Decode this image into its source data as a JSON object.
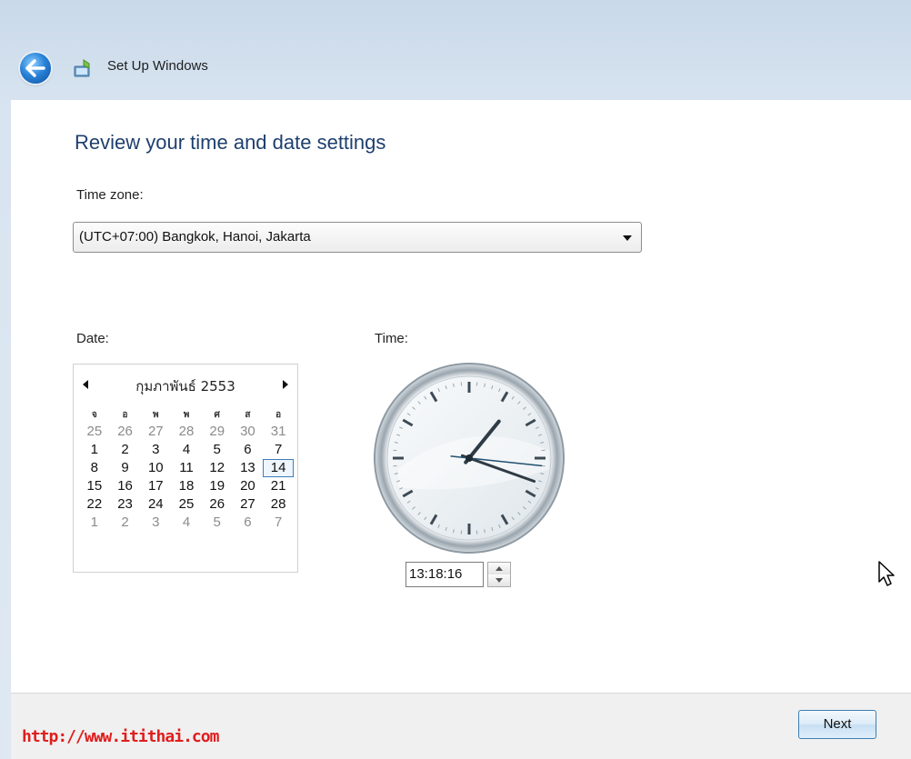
{
  "window": {
    "title": "Set Up Windows"
  },
  "page": {
    "title": "Review your time and date settings"
  },
  "timezone": {
    "label": "Time zone:",
    "value": "(UTC+07:00) Bangkok, Hanoi, Jakarta"
  },
  "date": {
    "label": "Date:",
    "month_label": "กุมภาพันธ์ 2553",
    "weekdays": [
      "อ",
      "จ",
      "อ",
      "พ",
      "พ",
      "ศ",
      "ส"
    ],
    "weekdays_shown": [
      "จ",
      "อ",
      "พ",
      "พ",
      "ศ",
      "ส",
      "อ"
    ],
    "days": [
      [
        "25",
        "26",
        "27",
        "28",
        "29",
        "30",
        "31"
      ],
      [
        "1",
        "2",
        "3",
        "4",
        "5",
        "6",
        "7"
      ],
      [
        "8",
        "9",
        "10",
        "11",
        "12",
        "13",
        "14"
      ],
      [
        "15",
        "16",
        "17",
        "18",
        "19",
        "20",
        "21"
      ],
      [
        "22",
        "23",
        "24",
        "25",
        "26",
        "27",
        "28"
      ],
      [
        "1",
        "2",
        "3",
        "4",
        "5",
        "6",
        "7"
      ]
    ],
    "selected_day": "14"
  },
  "time": {
    "label": "Time:",
    "value": "13:18:16",
    "hour": 13,
    "minute": 18,
    "second": 16
  },
  "footer": {
    "next_label": "Next"
  },
  "watermark": "http://www.itithai.com",
  "colors": {
    "title_blue": "#1e3f6e",
    "watermark_red": "#e01e1e",
    "button_border": "#3c7fb1"
  },
  "icons": [
    "back-arrow-icon",
    "setup-computer-icon",
    "dropdown-arrow-icon",
    "chevron-left-icon",
    "chevron-right-icon",
    "spin-up-icon",
    "spin-down-icon",
    "mouse-cursor-icon"
  ]
}
